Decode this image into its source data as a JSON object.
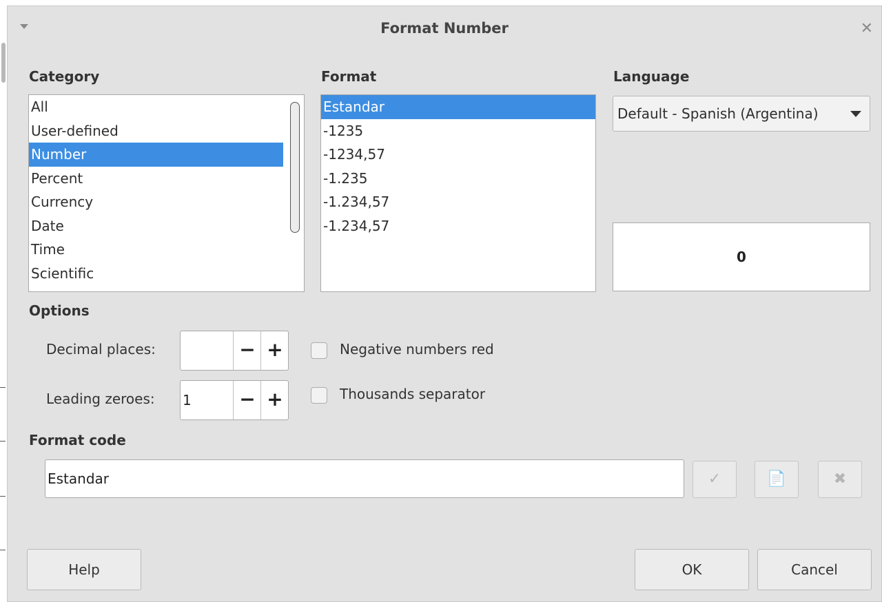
{
  "dialog": {
    "title": "Format Number"
  },
  "category": {
    "label": "Category",
    "items": [
      "All",
      "User-defined",
      "Number",
      "Percent",
      "Currency",
      "Date",
      "Time",
      "Scientific"
    ]
  },
  "format": {
    "label": "Format",
    "items": [
      "Estandar",
      "-1235",
      "-1234,57",
      "-1.235",
      "-1.234,57",
      "-1.234,57"
    ]
  },
  "language": {
    "label": "Language",
    "selected": "Default - Spanish (Argentina)"
  },
  "preview": {
    "value": "0"
  },
  "options": {
    "label": "Options",
    "decimal_places_label": "Decimal places:",
    "decimal_places_value": "",
    "leading_zeroes_label": "Leading zeroes:",
    "leading_zeroes_value": "1",
    "negative_red_label": "Negative numbers red",
    "thousands_sep_label": "Thousands separator"
  },
  "format_code": {
    "label": "Format code",
    "value": "Estandar"
  },
  "buttons": {
    "help": "Help",
    "ok": "OK",
    "cancel": "Cancel"
  },
  "icons": {
    "menu": "chevron-down-icon",
    "close": "close-icon",
    "accept": "check-icon",
    "comment": "comment-icon",
    "delete": "delete-icon"
  }
}
